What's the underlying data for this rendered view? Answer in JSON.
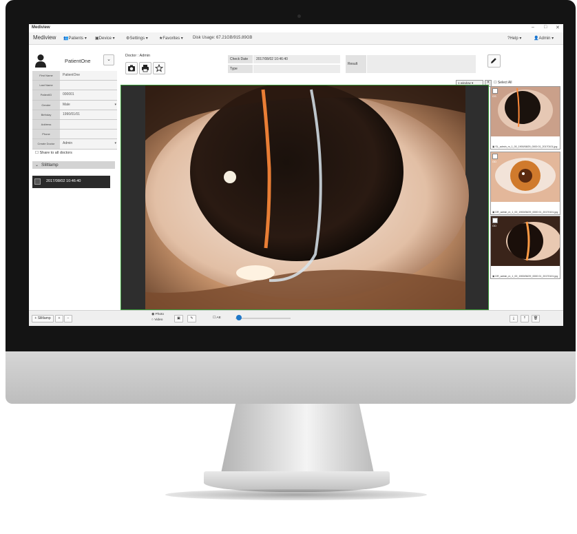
{
  "window": {
    "title": "Mediview",
    "minimize": "–",
    "maximize": "□",
    "close": "✕"
  },
  "menu": {
    "brand": "Mediview",
    "items": [
      "Patients ▾",
      "Device ▾",
      "Settings ▾",
      "Favorites ▾"
    ],
    "disk_usage": "Disk Usage: 67.21GB/915.89GB",
    "help": "Help ▾",
    "user": "Admin ▾"
  },
  "patient": {
    "name": "PatientOne",
    "fields": [
      {
        "label": "First Name",
        "value": "PatientOne"
      },
      {
        "label": "Last Name",
        "value": ""
      },
      {
        "label": "PatientID",
        "value": "000001"
      },
      {
        "label": "Gender",
        "value": "Male"
      },
      {
        "label": "Birthday",
        "value": "1990/01/01"
      },
      {
        "label": "Address",
        "value": ""
      },
      {
        "label": "Phone",
        "value": ""
      },
      {
        "label": "Create Doctor",
        "value": "Admin"
      }
    ],
    "share_label": "Share to all doctors",
    "section_label": "Sliltlamp",
    "records": [
      "2017/08/02 10:46:40"
    ]
  },
  "exam": {
    "doctor_label": "Doctor : Admin",
    "check_date_label": "Check Date",
    "check_date_value": "2017/08/02 10:46:40",
    "type_label": "Type",
    "result_label": "Result"
  },
  "viewer": {
    "window_select": "1 window ▾",
    "select_all": "Select All"
  },
  "thumbnails": [
    {
      "eye": "OS",
      "caption": "SL_admin_m_1_00_1900/08/29_0000 01_20170101.jpg"
    },
    {
      "eye": "OD",
      "caption": "DR_admin_m_1_00_1900/08/29_0000 01_20170101.jpg"
    },
    {
      "eye": "OD",
      "caption": "DR_admin_m_1_00_1900/08/29_0000 01_20170101.jpg"
    }
  ],
  "bottom": {
    "add_record": "+ Sliltlamp",
    "add": "+",
    "remove": "−",
    "photo_label": "Photo",
    "video_label": "Video",
    "ae_label": "AE"
  },
  "colors": {
    "viewer_border": "#3a9b3a",
    "slider_knob": "#1f78c8",
    "record_bg": "#2a2a2a"
  }
}
